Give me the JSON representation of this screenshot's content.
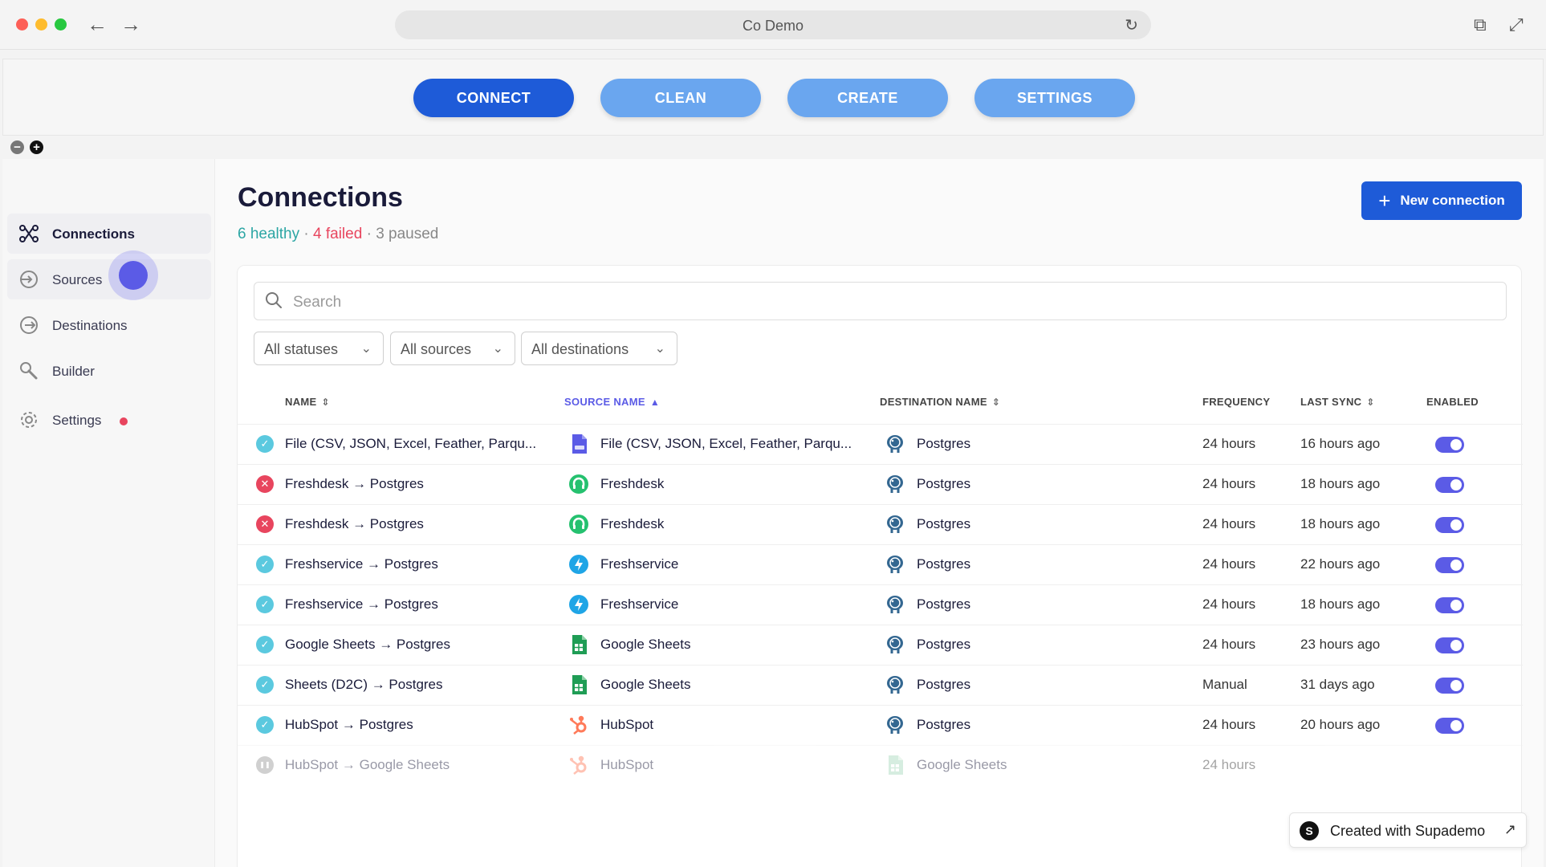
{
  "browser": {
    "title": "Co Demo"
  },
  "steps": [
    {
      "label": "CONNECT",
      "active": true
    },
    {
      "label": "CLEAN",
      "active": false
    },
    {
      "label": "CREATE",
      "active": false
    },
    {
      "label": "SETTINGS",
      "active": false
    }
  ],
  "sidebar": {
    "items": [
      {
        "label": "Connections",
        "icon": "connections-icon",
        "active": true
      },
      {
        "label": "Sources",
        "icon": "sources-icon",
        "active": false
      },
      {
        "label": "Destinations",
        "icon": "destinations-icon",
        "active": false
      },
      {
        "label": "Builder",
        "icon": "builder-icon",
        "active": false
      },
      {
        "label": "Settings",
        "icon": "gear-icon",
        "active": false
      }
    ]
  },
  "main": {
    "title": "Connections",
    "summary": {
      "healthy": "6 healthy",
      "sep1": " · ",
      "failed": "4 failed",
      "sep2": " · ",
      "paused": "3 paused"
    },
    "new_connection_label": "New connection",
    "search_placeholder": "Search",
    "filters": [
      "All statuses",
      "All sources",
      "All destinations"
    ],
    "columns": {
      "name": "NAME",
      "source": "SOURCE NAME",
      "destination": "DESTINATION NAME",
      "frequency": "FREQUENCY",
      "last_sync": "LAST SYNC",
      "enabled": "ENABLED"
    },
    "rows": [
      {
        "status": "ok",
        "name": "File (CSV, JSON, Excel, Feather, Parqu...",
        "source": "File (CSV, JSON, Excel, Feather, Parqu...",
        "source_icon": "file-icon",
        "destination": "Postgres",
        "frequency": "24 hours",
        "last_sync": "16 hours ago",
        "enabled": true
      },
      {
        "status": "fail",
        "name": "Freshdesk → Postgres",
        "source": "Freshdesk",
        "source_icon": "freshdesk-icon",
        "destination": "Postgres",
        "frequency": "24 hours",
        "last_sync": "18 hours ago",
        "enabled": true
      },
      {
        "status": "fail",
        "name": "Freshdesk → Postgres",
        "source": "Freshdesk",
        "source_icon": "freshdesk-icon",
        "destination": "Postgres",
        "frequency": "24 hours",
        "last_sync": "18 hours ago",
        "enabled": true
      },
      {
        "status": "ok",
        "name": "Freshservice → Postgres",
        "source": "Freshservice",
        "source_icon": "freshservice-icon",
        "destination": "Postgres",
        "frequency": "24 hours",
        "last_sync": "22 hours ago",
        "enabled": true
      },
      {
        "status": "ok",
        "name": "Freshservice → Postgres",
        "source": "Freshservice",
        "source_icon": "freshservice-icon",
        "destination": "Postgres",
        "frequency": "24 hours",
        "last_sync": "18 hours ago",
        "enabled": true
      },
      {
        "status": "ok",
        "name": "Google Sheets → Postgres",
        "source": "Google Sheets",
        "source_icon": "google-sheets-icon",
        "destination": "Postgres",
        "frequency": "24 hours",
        "last_sync": "23 hours ago",
        "enabled": true
      },
      {
        "status": "ok",
        "name": "Sheets (D2C) → Postgres",
        "source": "Google Sheets",
        "source_icon": "google-sheets-icon",
        "destination": "Postgres",
        "frequency": "Manual",
        "last_sync": "31 days ago",
        "enabled": true
      },
      {
        "status": "ok",
        "name": "HubSpot → Postgres",
        "source": "HubSpot",
        "source_icon": "hubspot-icon",
        "destination": "Postgres",
        "frequency": "24 hours",
        "last_sync": "20 hours ago",
        "enabled": true
      },
      {
        "status": "paused",
        "name": "HubSpot → Google Sheets",
        "source": "HubSpot",
        "source_icon": "hubspot-icon",
        "destination": "Google Sheets",
        "frequency": "24 hours",
        "last_sync": "",
        "enabled": false
      }
    ]
  },
  "badge": {
    "text": "Created with Supademo"
  }
}
